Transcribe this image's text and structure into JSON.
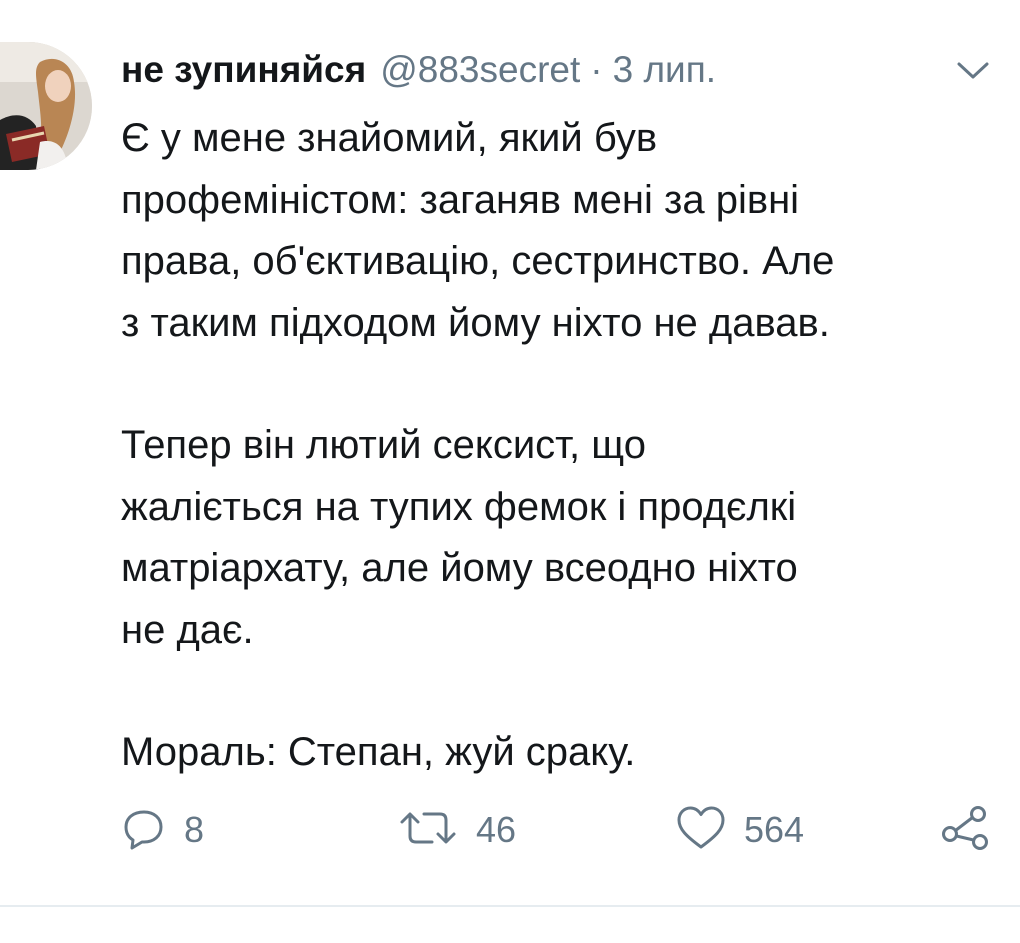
{
  "tweet": {
    "author_name": "не зупиняйся",
    "handle": "@883secret",
    "separator": "·",
    "time": "3 лип.",
    "paragraphs": [
      "Є у мене знайомий, який був\nпрофеміністом: заганяв мені за рівні\nправа, об'єктивацію, сестринство. Але\nз таким підходом йому ніхто не давав.",
      "Тепер він лютий сексист, що\nжаліється на тупих фемок і продєлкі\nматріархату, але йому всеодно ніхто\nне дає.",
      "Мораль: Степан, жуй сраку."
    ],
    "actions": {
      "reply_count": "8",
      "retweet_count": "46",
      "like_count": "564"
    }
  },
  "icons": {
    "avatar": "avatar-photo",
    "menu": "chevron-down-icon",
    "reply": "reply-icon",
    "retweet": "retweet-icon",
    "like": "heart-icon",
    "share": "share-icon"
  },
  "colors": {
    "text": "#14171a",
    "muted": "#657786",
    "divider": "#e6ecf0"
  }
}
